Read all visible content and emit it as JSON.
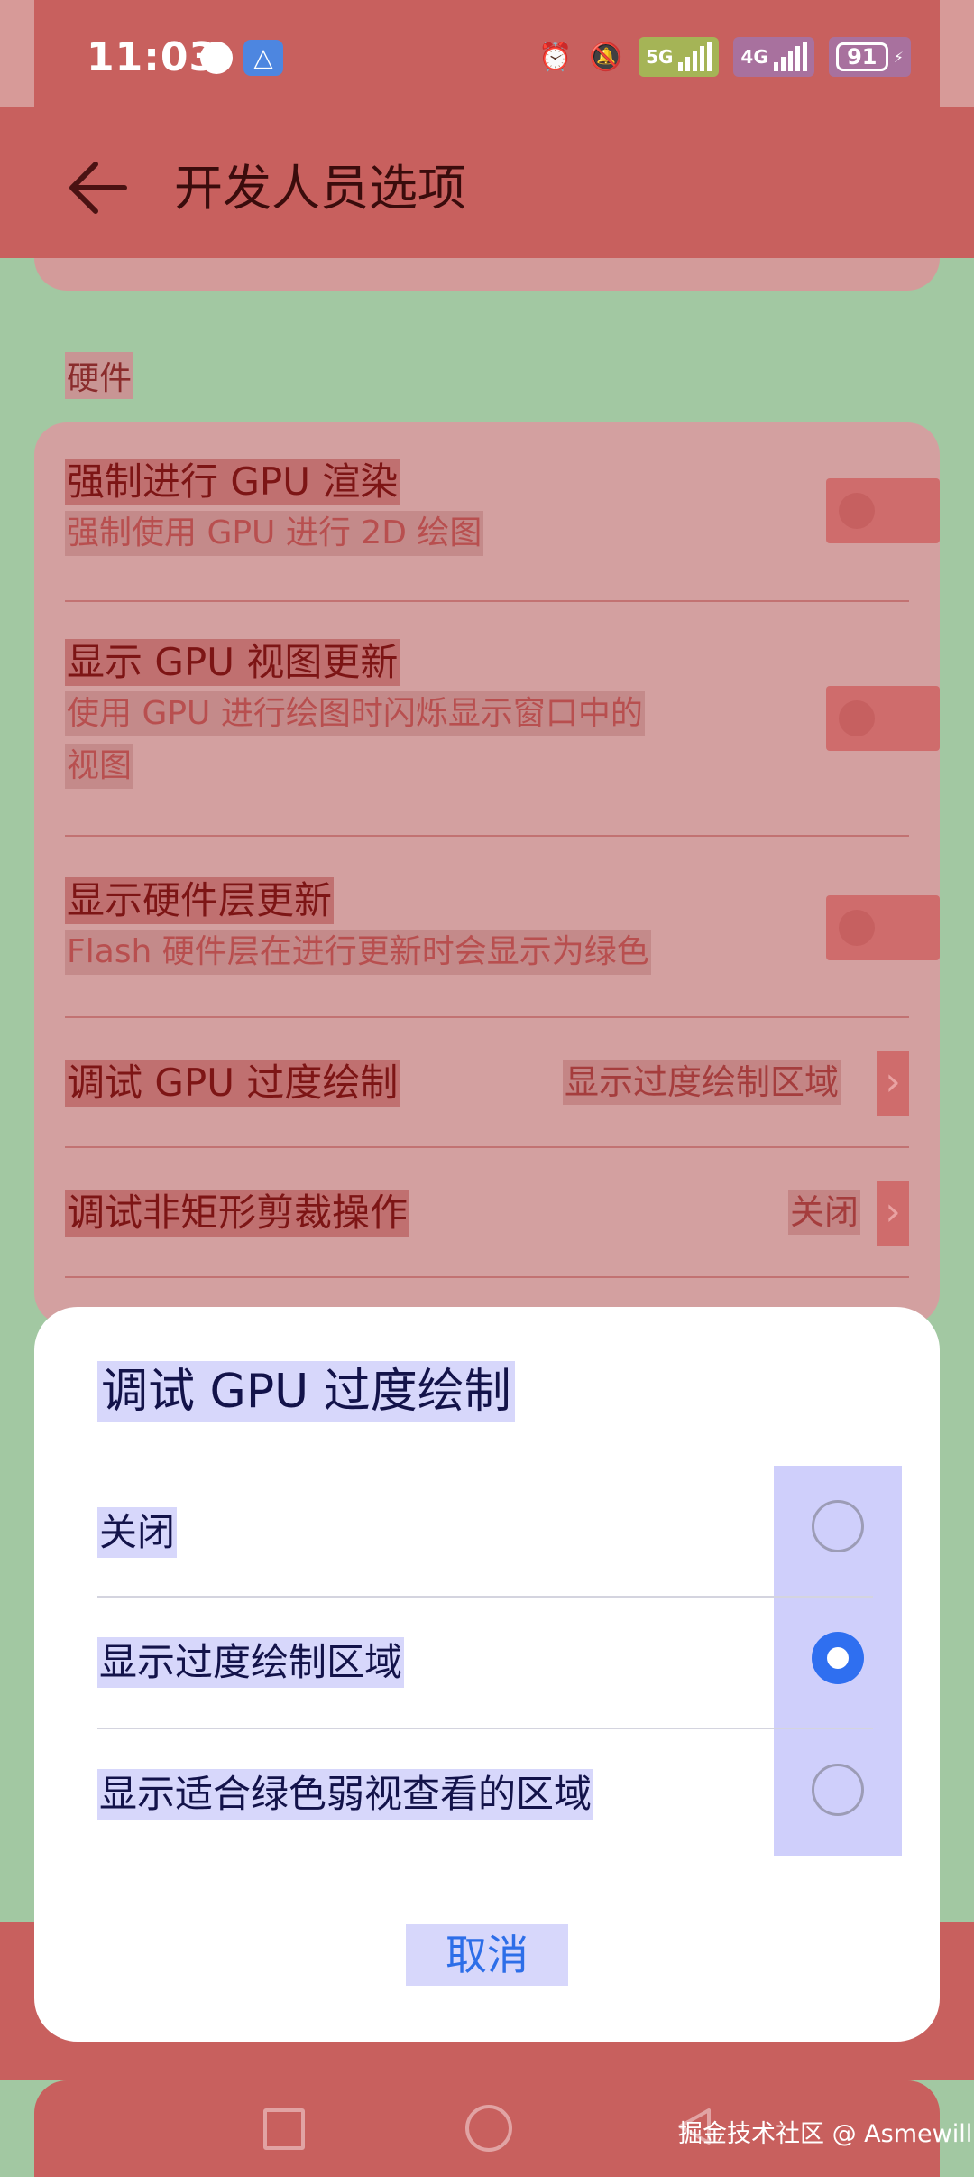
{
  "status_bar": {
    "time": "11:03",
    "net1": "5G",
    "net2": "4G",
    "battery": "91"
  },
  "app_bar": {
    "title": "开发人员选项"
  },
  "section": {
    "header": "硬件"
  },
  "settings": [
    {
      "title": "强制进行 GPU 渲染",
      "subtitle": "强制使用 GPU 进行 2D 绘图",
      "control": "toggle",
      "enabled": false
    },
    {
      "title": "显示 GPU 视图更新",
      "subtitle_line1": "使用 GPU 进行绘图时闪烁显示窗口中的",
      "subtitle_line2": "视图",
      "control": "toggle",
      "enabled": false
    },
    {
      "title": "显示硬件层更新",
      "subtitle": "Flash 硬件层在进行更新时会显示为绿色",
      "control": "toggle",
      "enabled": false
    },
    {
      "title": "调试 GPU 过度绘制",
      "value": "显示过度绘制区域",
      "control": "chevron"
    },
    {
      "title": "调试非矩形剪裁操作",
      "value": "关闭",
      "control": "chevron"
    }
  ],
  "dialog": {
    "title": "调试 GPU 过度绘制",
    "options": [
      {
        "label": "关闭",
        "selected": false
      },
      {
        "label": "显示过度绘制区域",
        "selected": true
      },
      {
        "label": "显示适合绿色弱视查看的区域",
        "selected": false
      }
    ],
    "cancel_label": "取消"
  },
  "watermark": "掘金技术社区 @ Asmewill",
  "colors": {
    "accent": "#2f6ff0",
    "dialog_text": "#13134a",
    "overlay_red": "#c8605e",
    "overlay_green": "#a2c8a2"
  }
}
